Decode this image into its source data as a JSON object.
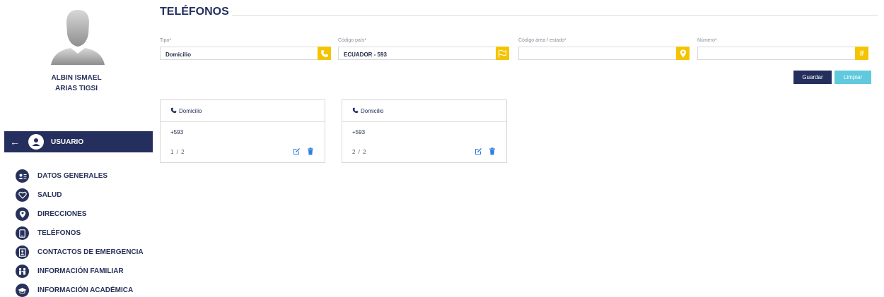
{
  "user": {
    "first_line": "ALBIN ISMAEL",
    "second_line": "ARIAS TIGSI"
  },
  "sidebar": {
    "header_label": "USUARIO",
    "items": [
      {
        "label": "DATOS GENERALES",
        "icon": "id-card-icon"
      },
      {
        "label": "SALUD",
        "icon": "heart-stethoscope-icon"
      },
      {
        "label": "DIRECCIONES",
        "icon": "map-pin-icon"
      },
      {
        "label": "TELÉFONOS",
        "icon": "phone-icon"
      },
      {
        "label": "CONTACTOS DE EMERGENCIA",
        "icon": "contact-book-icon"
      },
      {
        "label": "INFORMACIÓN FAMILIAR",
        "icon": "family-icon"
      },
      {
        "label": "INFORMACIÓN ACADÉMICA",
        "icon": "graduation-cap-icon"
      }
    ]
  },
  "page": {
    "title": "TELÉFONOS"
  },
  "form": {
    "tipo": {
      "label": "Tipo*",
      "value": "Domicilio"
    },
    "codigo_pais": {
      "label": "Código país*",
      "value": "ECUADOR - 593"
    },
    "codigo_area": {
      "label": "Código área / estado*",
      "value": ""
    },
    "numero": {
      "label": "Número*",
      "value": "",
      "icon_text": "#"
    }
  },
  "buttons": {
    "save": "Guardar",
    "clear": "Limpiar"
  },
  "cards": [
    {
      "type": "Domicilio",
      "number": "+593",
      "page": "1 / 2"
    },
    {
      "type": "Domicilio",
      "number": "+593",
      "page": "2 / 2"
    }
  ],
  "colors": {
    "primary": "#252f5e",
    "accent": "#f5c400",
    "info": "#5fc9dd",
    "edit": "#2f7fe0"
  }
}
